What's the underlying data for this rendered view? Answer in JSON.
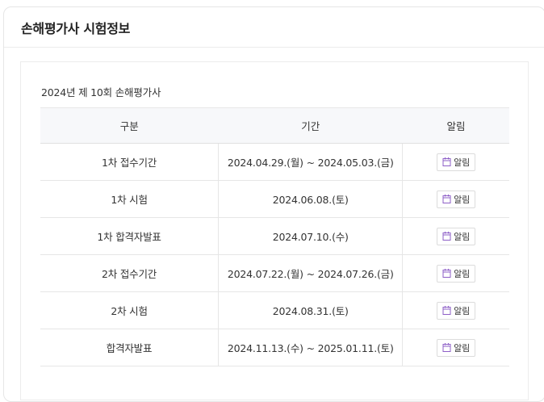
{
  "header": {
    "title": "손해평가사 시험정보"
  },
  "exam": {
    "name": "2024년 제 10회 손해평가사"
  },
  "table": {
    "columns": [
      "구분",
      "기간",
      "알림"
    ],
    "rows": [
      {
        "division": "1차 접수기간",
        "period": "2024.04.29.(월) ~ 2024.05.03.(금)",
        "alarm": "알림"
      },
      {
        "division": "1차 시험",
        "period": "2024.06.08.(토)",
        "alarm": "알림"
      },
      {
        "division": "1차 합격자발표",
        "period": "2024.07.10.(수)",
        "alarm": "알림"
      },
      {
        "division": "2차 접수기간",
        "period": "2024.07.22.(월) ~ 2024.07.26.(금)",
        "alarm": "알림"
      },
      {
        "division": "2차 시험",
        "period": "2024.08.31.(토)",
        "alarm": "알림"
      },
      {
        "division": "합격자발표",
        "period": "2024.11.13.(수) ~ 2025.01.11.(토)",
        "alarm": "알림"
      }
    ]
  },
  "icons": {
    "alarm": "calendar-icon"
  },
  "colors": {
    "calendar_icon": "#8e5fc7",
    "header_bg": "#f7f8fa",
    "border": "#e6e6e6"
  }
}
